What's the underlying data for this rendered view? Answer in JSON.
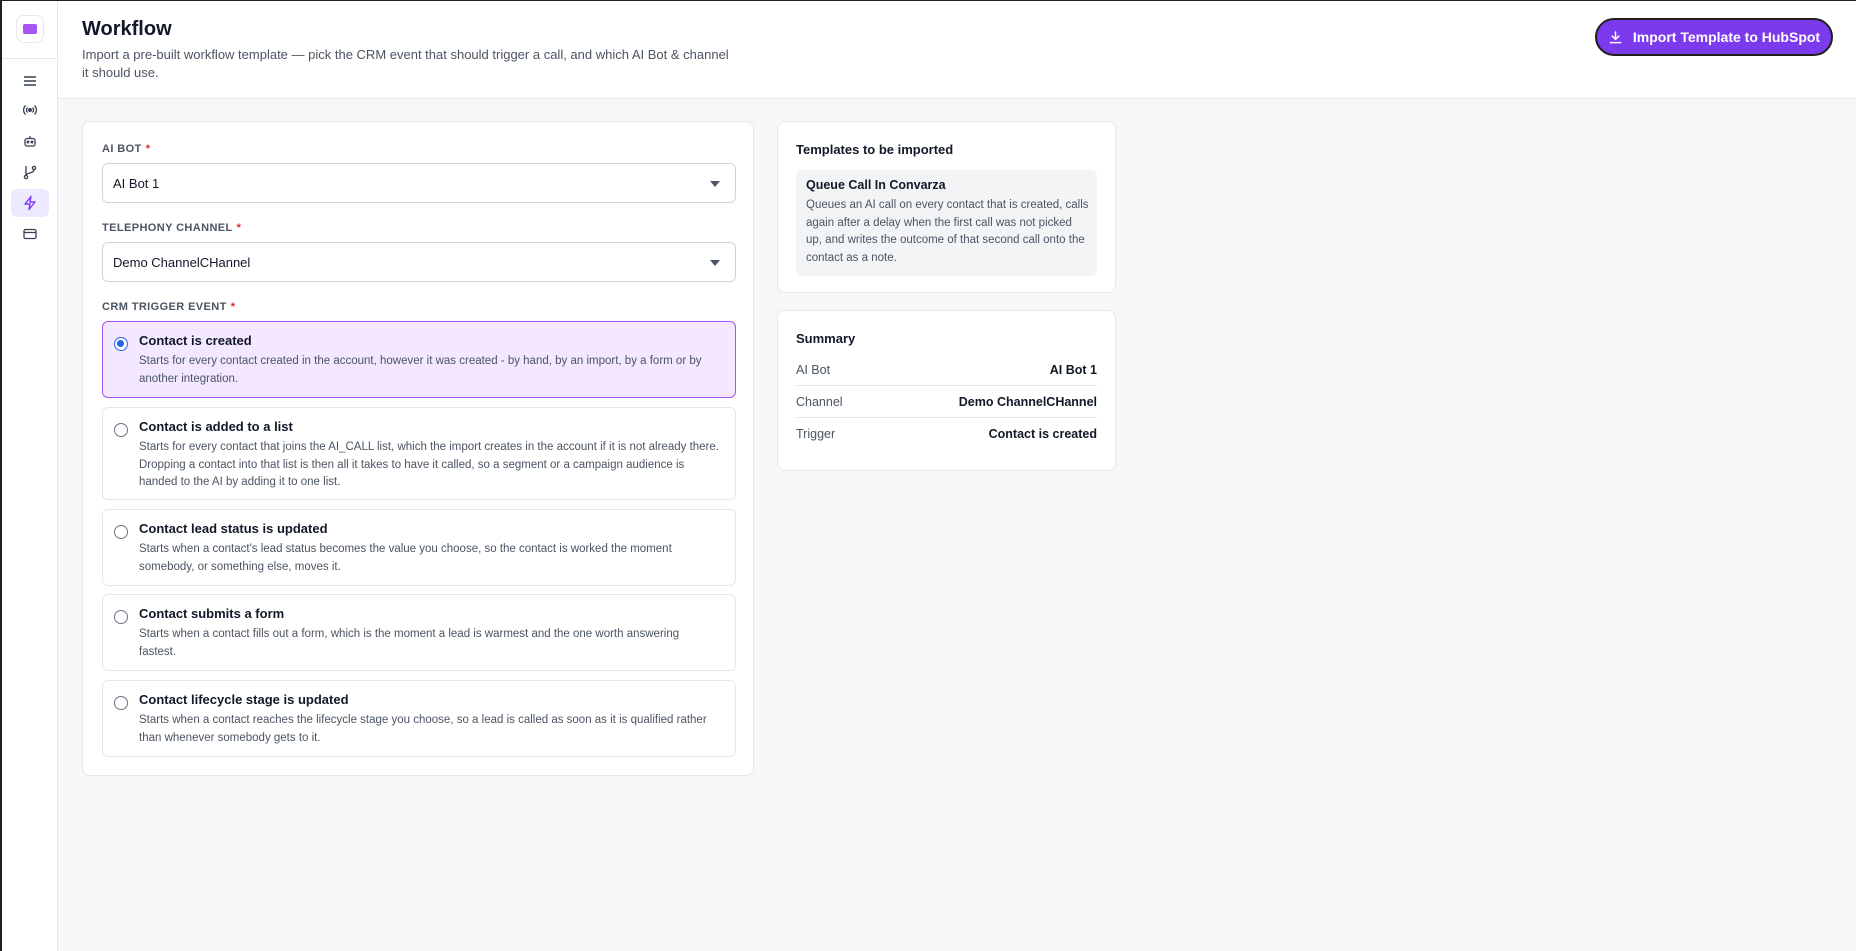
{
  "header": {
    "title": "Workflow",
    "subtitle": "Import a pre-built workflow template — pick the CRM event that should trigger a call, and which AI Bot & channel it should use.",
    "import_button": "Import Template to HubSpot"
  },
  "sidebar": {
    "items": [
      {
        "icon": "menu-icon"
      },
      {
        "icon": "broadcast-icon"
      },
      {
        "icon": "bot-icon"
      },
      {
        "icon": "git-branch-icon"
      },
      {
        "icon": "lightning-icon",
        "active": true
      },
      {
        "icon": "credit-card-icon"
      }
    ]
  },
  "form": {
    "ai_bot": {
      "label": "AI BOT",
      "required": "*",
      "value": "AI Bot 1"
    },
    "channel": {
      "label": "TELEPHONY CHANNEL",
      "required": "*",
      "value": "Demo ChannelCHannel"
    },
    "trigger": {
      "label": "CRM TRIGGER EVENT",
      "required": "*",
      "options": [
        {
          "title": "Contact is created",
          "desc": "Starts for every contact created in the account, however it was created - by hand, by an import, by a form or by another integration.",
          "selected": true
        },
        {
          "title": "Contact is added to a list",
          "desc": "Starts for every contact that joins the AI_CALL list, which the import creates in the account if it is not already there. Dropping a contact into that list is then all it takes to have it called, so a segment or a campaign audience is handed to the AI by adding it to one list.",
          "selected": false
        },
        {
          "title": "Contact lead status is updated",
          "desc": "Starts when a contact's lead status becomes the value you choose, so the contact is worked the moment somebody, or something else, moves it.",
          "selected": false
        },
        {
          "title": "Contact submits a form",
          "desc": "Starts when a contact fills out a form, which is the moment a lead is warmest and the one worth answering fastest.",
          "selected": false
        },
        {
          "title": "Contact lifecycle stage is updated",
          "desc": "Starts when a contact reaches the lifecycle stage you choose, so a lead is called as soon as it is qualified rather than whenever somebody gets to it.",
          "selected": false
        }
      ]
    }
  },
  "templates": {
    "title": "Templates to be imported",
    "item": {
      "name": "Queue Call In Convarza",
      "desc": "Queues an AI call on every contact that is created, calls again after a delay when the first call was not picked up, and writes the outcome of that second call onto the contact as a note."
    }
  },
  "summary": {
    "title": "Summary",
    "rows": [
      {
        "key": "AI Bot",
        "value": "AI Bot 1"
      },
      {
        "key": "Channel",
        "value": "Demo ChannelCHannel"
      },
      {
        "key": "Trigger",
        "value": "Contact is created"
      }
    ]
  },
  "colors": {
    "accent": "#7c3aed",
    "selected_bg": "#f3e8ff",
    "radio": "#2563eb"
  }
}
